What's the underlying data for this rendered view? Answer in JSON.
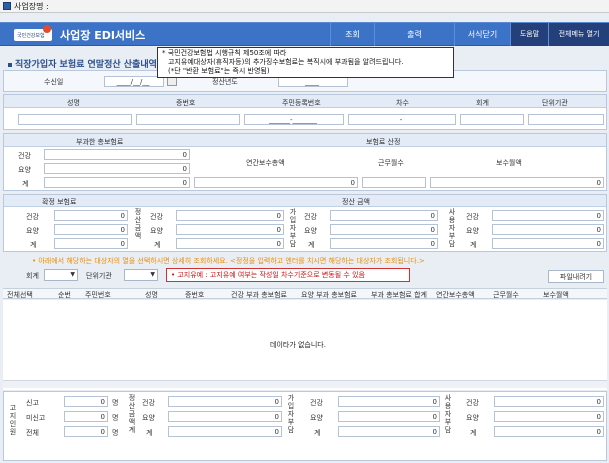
{
  "window": {
    "title": "사업장명 :"
  },
  "header": {
    "logo_text": "국민건강보험",
    "app_title": "사업장 EDI서비스",
    "menu": [
      "조회",
      "출력",
      "서식닫기",
      "도움말",
      "전체메뉴 열기"
    ]
  },
  "tooltip": {
    "lines": [
      "* 국민건강보험법 시행규칙 제50조에 따라",
      "고지유예대상자(휴직자등)의 추가징수보험료는 복직시에 부과됨을 알려드립니다.",
      "(*단 \"반환 보험료\"는 즉시 반영됨)"
    ]
  },
  "page_title": "직장가입자 보험료 연말정산 산출내역서",
  "search": {
    "receipt_label": "수신일",
    "receipt_value": "____/__/__",
    "year_label": "정산년도",
    "year_value": "____"
  },
  "person_header": {
    "cols": [
      "성명",
      "증번호",
      "주민등록번호",
      "차수",
      "회계",
      "단위기관"
    ],
    "ssn_value": "______-_______",
    "seq_value": "-"
  },
  "imposed": {
    "title": "부과한 총보험료",
    "rows": [
      {
        "label": "건강",
        "value": "0"
      },
      {
        "label": "요양",
        "value": "0"
      },
      {
        "label": "계",
        "value": "0"
      }
    ]
  },
  "calc": {
    "title": "보험료 산정",
    "cols": [
      "연간보수총액",
      "근무월수",
      "보수월액"
    ],
    "values": [
      "0",
      "",
      "0"
    ]
  },
  "confirmed": {
    "title": "확정 보험료",
    "rows": [
      {
        "label": "건강",
        "value": "0"
      },
      {
        "label": "요양",
        "value": "0"
      },
      {
        "label": "계",
        "value": "0"
      }
    ]
  },
  "settle": {
    "title": "정산 금액",
    "groups": [
      {
        "vlabel": "정산금액",
        "rows": [
          {
            "label": "건강",
            "value": "0"
          },
          {
            "label": "요양",
            "value": "0"
          },
          {
            "label": "계",
            "value": "0"
          }
        ]
      },
      {
        "vlabel": "가입자부담",
        "rows": [
          {
            "label": "건강",
            "value": "0"
          },
          {
            "label": "요양",
            "value": "0"
          },
          {
            "label": "계",
            "value": "0"
          }
        ]
      },
      {
        "vlabel": "사용자부담",
        "rows": [
          {
            "label": "건강",
            "value": "0"
          },
          {
            "label": "요양",
            "value": "0"
          },
          {
            "label": "계",
            "value": "0"
          }
        ]
      }
    ]
  },
  "notice": "• 아래에서 해당하는 대상자의 열을 선택하시면 상세히 조회하세요. <정정을 입력하고 엔터를 치시면 해당하는 대상자가 조회됩니다.>",
  "filter": {
    "account_label": "회계",
    "unit_label": "단위기관",
    "download_label": "파일내려기"
  },
  "warning": "• 고지유예 : 고지유예 여부는 작성일 차수기준으로 변동될 수 있음",
  "grid": {
    "columns": [
      "전체선택",
      "순번",
      "주민번호",
      "성명",
      "증번호",
      "건강 부과 총보험료",
      "요양 부과 총보험료",
      "부과 총보험료 합계",
      "연간보수총액",
      "근무월수",
      "보수월액"
    ],
    "empty_text": "데이타가 없습니다."
  },
  "footer": {
    "left_vlabel": "고지인원",
    "counts": [
      {
        "label": "신고",
        "value": "0",
        "unit": "명"
      },
      {
        "label": "미신고",
        "value": "0",
        "unit": "명"
      },
      {
        "label": "전체",
        "value": "0",
        "unit": "명"
      }
    ],
    "groups": [
      {
        "vlabel": "정산금액계",
        "rows": [
          {
            "label": "건강",
            "value": "0"
          },
          {
            "label": "요양",
            "value": "0"
          },
          {
            "label": "계",
            "value": "0"
          }
        ]
      },
      {
        "vlabel": "가입자부담",
        "rows": [
          {
            "label": "건강",
            "value": "0"
          },
          {
            "label": "요양",
            "value": "0"
          },
          {
            "label": "계",
            "value": "0"
          }
        ]
      },
      {
        "vlabel": "사용자부담",
        "rows": [
          {
            "label": "건강",
            "value": "0"
          },
          {
            "label": "요양",
            "value": "0"
          },
          {
            "label": "계",
            "value": "0"
          }
        ]
      }
    ]
  }
}
